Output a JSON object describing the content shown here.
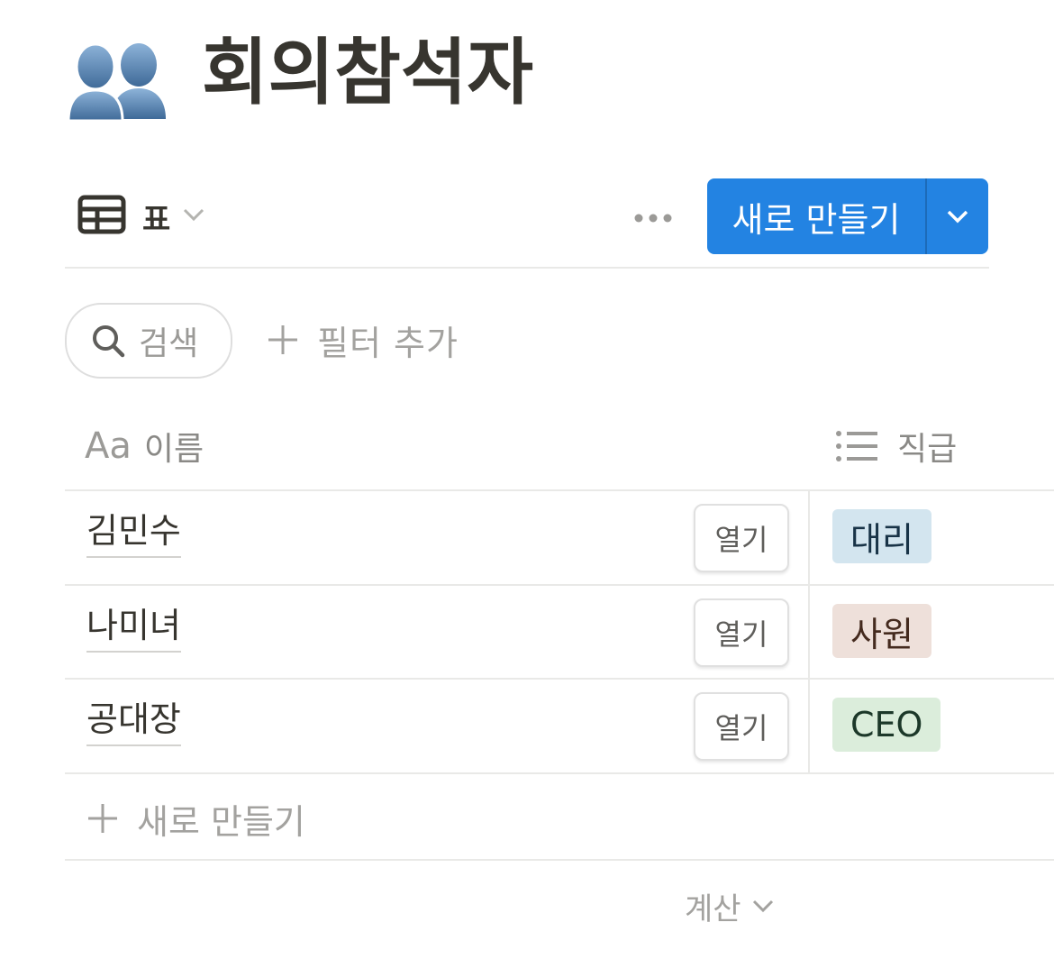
{
  "page": {
    "icon": "busts-in-silhouette-icon",
    "title": "회의참석자"
  },
  "toolbar": {
    "view_label": "표",
    "new_button_label": "새로 만들기",
    "accent_color": "#2383e2"
  },
  "filters": {
    "search_placeholder": "검색",
    "add_filter_label": "필터 추가"
  },
  "table": {
    "columns": [
      {
        "icon": "text-type-icon",
        "icon_text": "Aa",
        "label": "이름"
      },
      {
        "icon": "list-icon",
        "label": "직급"
      }
    ],
    "open_label": "열기",
    "rows": [
      {
        "name": "김민수",
        "rank": "대리",
        "rank_bg": "#d3e5ef",
        "rank_fg": "#183347"
      },
      {
        "name": "나미녀",
        "rank": "사원",
        "rank_bg": "#eee0da",
        "rank_fg": "#442a1e"
      },
      {
        "name": "공대장",
        "rank": "CEO",
        "rank_bg": "#dbeddb",
        "rank_fg": "#1c3829"
      }
    ],
    "new_row_label": "새로 만들기",
    "calculate_label": "계산"
  }
}
